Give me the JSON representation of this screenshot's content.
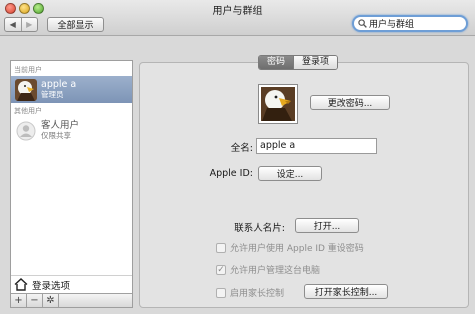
{
  "window": {
    "title": "用户与群组"
  },
  "toolbar": {
    "back_icon": "◀",
    "forward_icon": "▶",
    "show_all_label": "全部显示",
    "search_value": "用户与群组"
  },
  "sidebar": {
    "current_user_heading": "当前用户",
    "current_user": {
      "name": "apple a",
      "role": "管理员"
    },
    "other_users_heading": "其他用户",
    "guest_user": {
      "name": "客人用户",
      "role": "仅限共享"
    },
    "login_options_label": "登录选项",
    "add_icon": "+",
    "remove_icon": "−",
    "gear_icon": "✲"
  },
  "tabs": [
    {
      "label": "密码",
      "active": true
    },
    {
      "label": "登录项",
      "active": false
    }
  ],
  "account": {
    "change_password_label": "更改密码...",
    "full_name_label": "全名:",
    "full_name_value": "apple a",
    "apple_id_label": "Apple ID:",
    "apple_id_button": "设定...",
    "contact_card_label": "联系人名片:",
    "contact_card_button": "打开...",
    "allow_reset_label": "允许用户使用 Apple ID 重设密码",
    "allow_admin_label": "允许用户管理这台电脑",
    "parental_label": "启用家长控制",
    "parental_button": "打开家长控制..."
  },
  "checkboxes": {
    "allow_reset": false,
    "allow_admin": true,
    "parental": false
  }
}
